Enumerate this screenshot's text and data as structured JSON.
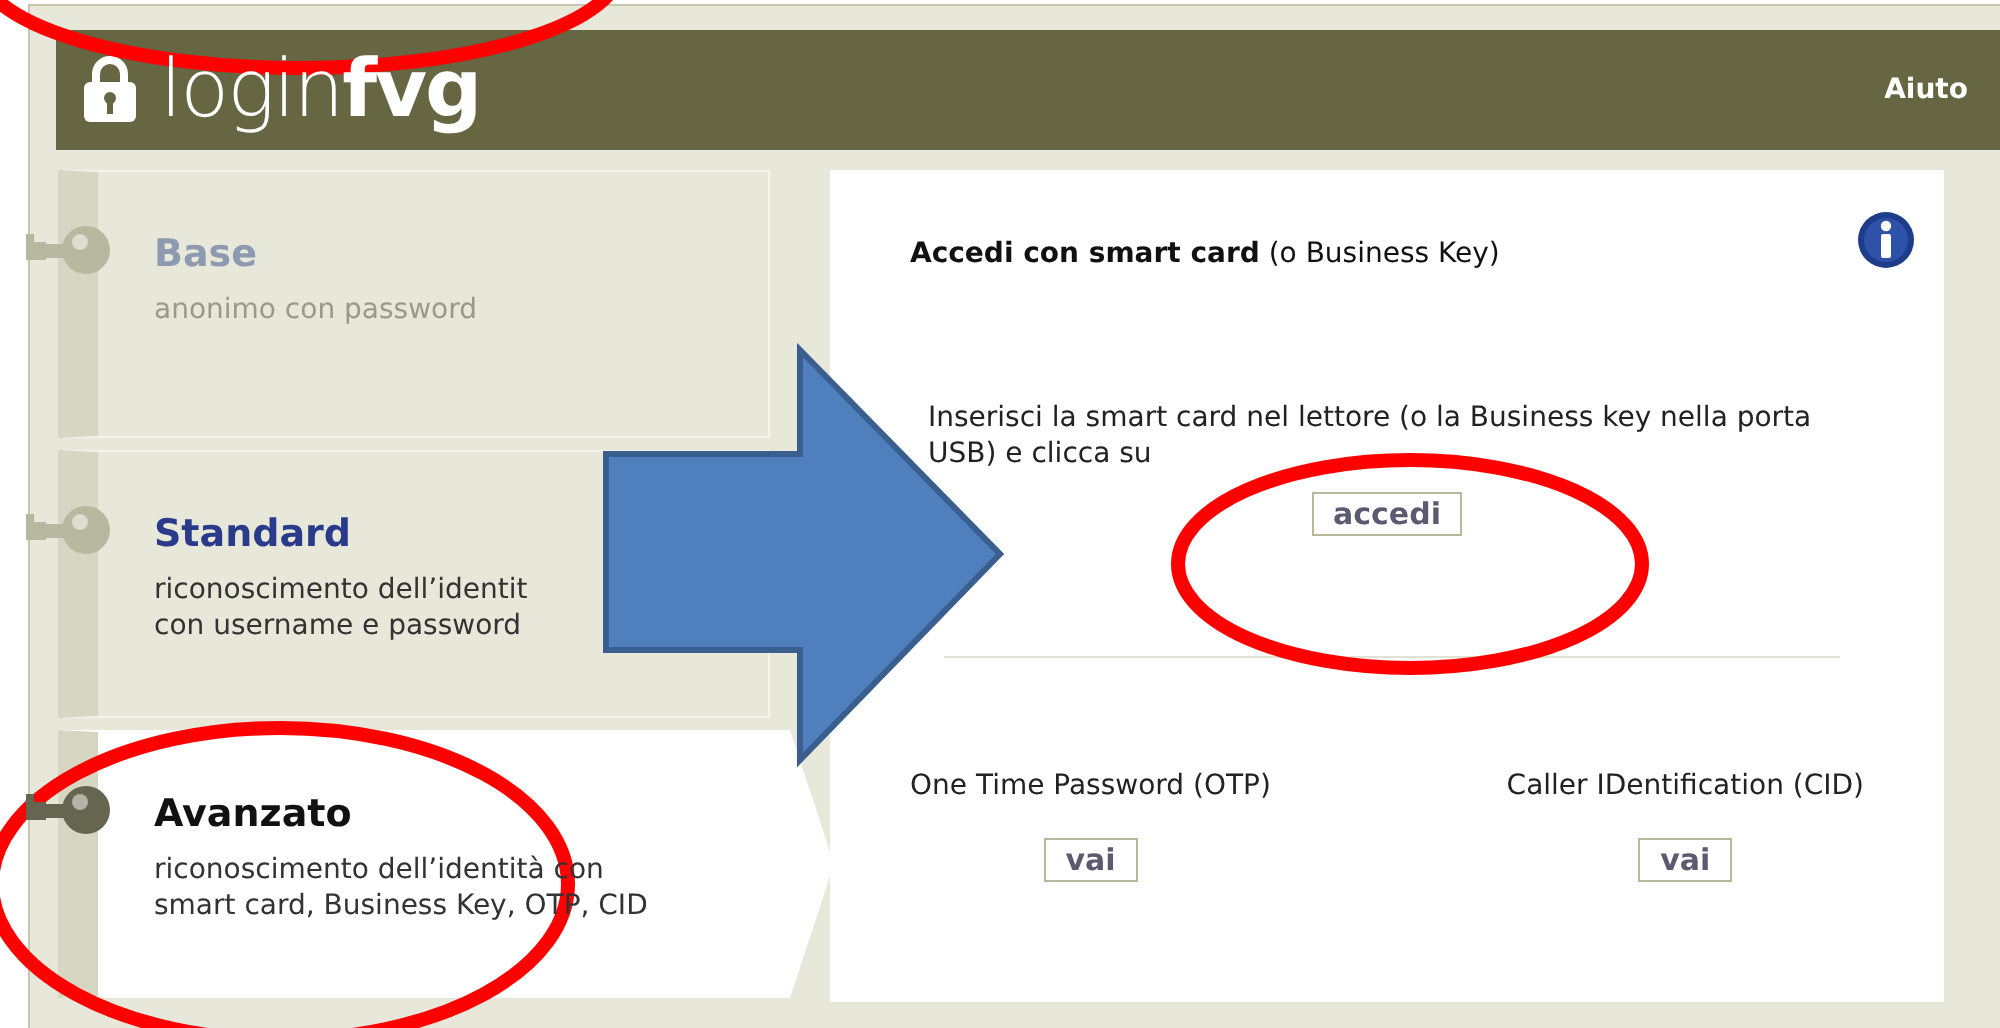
{
  "header": {
    "logo_light": "login",
    "logo_bold": "fvg",
    "help_link": "Aiuto"
  },
  "levels": [
    {
      "title": "Base",
      "description": "anonimo con password",
      "disabled": true,
      "selected": false
    },
    {
      "title": "Standard",
      "description": "riconoscimento dell’identit\ncon username e password",
      "disabled": false,
      "selected": false
    },
    {
      "title": "Avanzato",
      "description": "riconoscimento dell’identità con\nsmart card, Business Key, OTP, CID",
      "disabled": false,
      "selected": true
    }
  ],
  "panel": {
    "heading": "**Accedi con smart card** (o Business Key)",
    "instruction": "Inserisci la smart card nel lettore (o la Business key nella porta USB) e clicca su",
    "primary_button": "accedi",
    "options": [
      {
        "label": "One Time Password (OTP)",
        "button": "vai"
      },
      {
        "label": "Caller IDentification (CID)",
        "button": "vai"
      }
    ]
  }
}
